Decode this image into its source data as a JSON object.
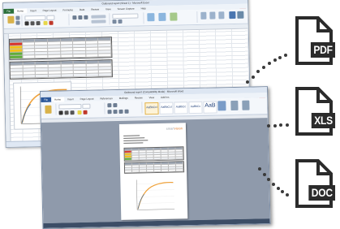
{
  "excel_window": {
    "title": "Outbound report (Sheet 1) - Microsoft Excel",
    "tabs": [
      "File",
      "Home",
      "Insert",
      "Page Layout",
      "Formulas",
      "Data",
      "Review",
      "View",
      "Screen Capture",
      "Help"
    ]
  },
  "word_window": {
    "title": "Outbound report (Compatibility Mode) - Microsoft Word",
    "tabs": [
      "File",
      "Home",
      "Insert",
      "Page Layout",
      "References",
      "Mailings",
      "Review",
      "View",
      "Add-Ins"
    ],
    "styles": [
      {
        "sample": "AaBbCcI",
        "name": "Normal"
      },
      {
        "sample": "AaBbCcI",
        "name": "No Spacing"
      },
      {
        "sample": "AaBbCc",
        "name": "Heading 1"
      },
      {
        "sample": "AaBbCc",
        "name": "Heading 2"
      },
      {
        "sample": "AaB",
        "name": "Title"
      }
    ],
    "page": {
      "logo": [
        "smart",
        "vision"
      ]
    }
  },
  "exports": [
    {
      "label": "PDF",
      "icon": "pdf-file-icon"
    },
    {
      "label": "XLS",
      "icon": "xls-file-icon"
    },
    {
      "label": "DOC",
      "icon": "doc-file-icon"
    }
  ],
  "colors": {
    "excel_accent": "#2c6f3a",
    "word_accent": "#2b579a",
    "chart_curve": "#f0a23a",
    "icon_dark": "#2b2b2b",
    "status_red": "#d9342b",
    "status_amber": "#f3c316",
    "status_green": "#5fae3a"
  }
}
